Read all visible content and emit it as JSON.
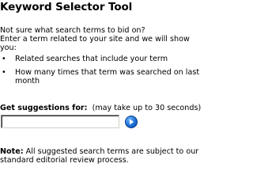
{
  "tool": {
    "title": "Keyword Selector Tool"
  },
  "intro": {
    "line1": "Not sure what search terms to bid on?",
    "line2": "Enter a term related to your site and we will show",
    "line3": "you:"
  },
  "bullets": [
    {
      "marker": "•",
      "text": "Related searches that include your term"
    },
    {
      "marker": "•",
      "text": "How many times that term was searched on last month"
    }
  ],
  "suggestions": {
    "label": "Get suggestions for:",
    "hint": "(may take up to 30 seconds)",
    "input_value": "",
    "go_icon": "arrow-right-circle-icon",
    "go_color": "#1e6fd6"
  },
  "note": {
    "label": "Note:",
    "line1": "All suggested search terms are subject to our",
    "line2": "standard editorial review process."
  }
}
